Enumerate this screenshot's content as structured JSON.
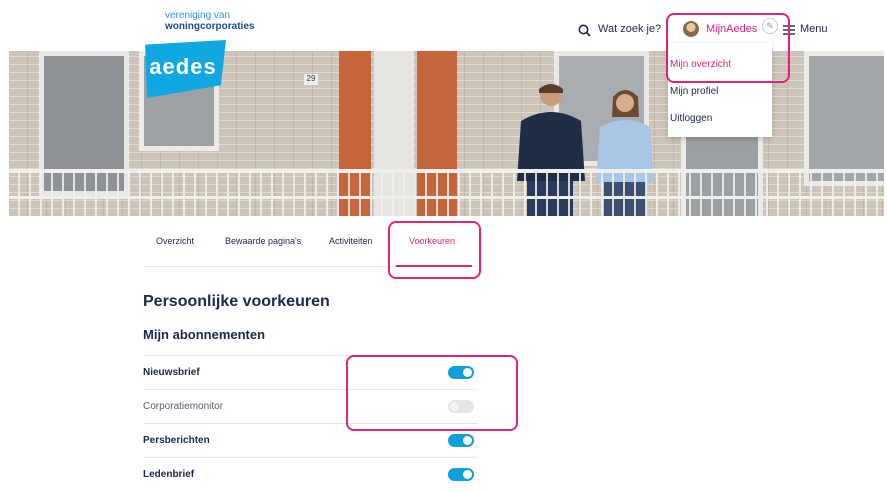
{
  "header": {
    "org_line1": "vereniging van",
    "org_line2": "woningcorporaties",
    "logo_text": "aedes",
    "search_label": "Wat zoek je?",
    "account_label": "MijnAedes",
    "menu_label": "Menu"
  },
  "hero": {
    "house_number": "29"
  },
  "dropdown": {
    "items": [
      {
        "label": "Mijn overzicht",
        "active": true
      },
      {
        "label": "Mijn profiel",
        "active": false
      },
      {
        "label": "Uitloggen",
        "active": false
      }
    ]
  },
  "tabs": [
    {
      "label": "Overzicht",
      "active": false
    },
    {
      "label": "Bewaarde pagina's",
      "active": false
    },
    {
      "label": "Activiteiten",
      "active": false
    },
    {
      "label": "Voorkeuren",
      "active": true
    }
  ],
  "content": {
    "title": "Persoonlijke voorkeuren",
    "subtitle": "Mijn abonnementen",
    "subscriptions": [
      {
        "label": "Nieuwsbrief",
        "enabled": true
      },
      {
        "label": "Corporatiemonitor",
        "enabled": false
      },
      {
        "label": "Persberichten",
        "enabled": true
      },
      {
        "label": "Ledenbrief",
        "enabled": true
      }
    ]
  },
  "colors": {
    "accent": "#e0237a",
    "toggle_on": "#0f9fdc",
    "brand": "#11a7e0",
    "text": "#1a2a4a"
  }
}
